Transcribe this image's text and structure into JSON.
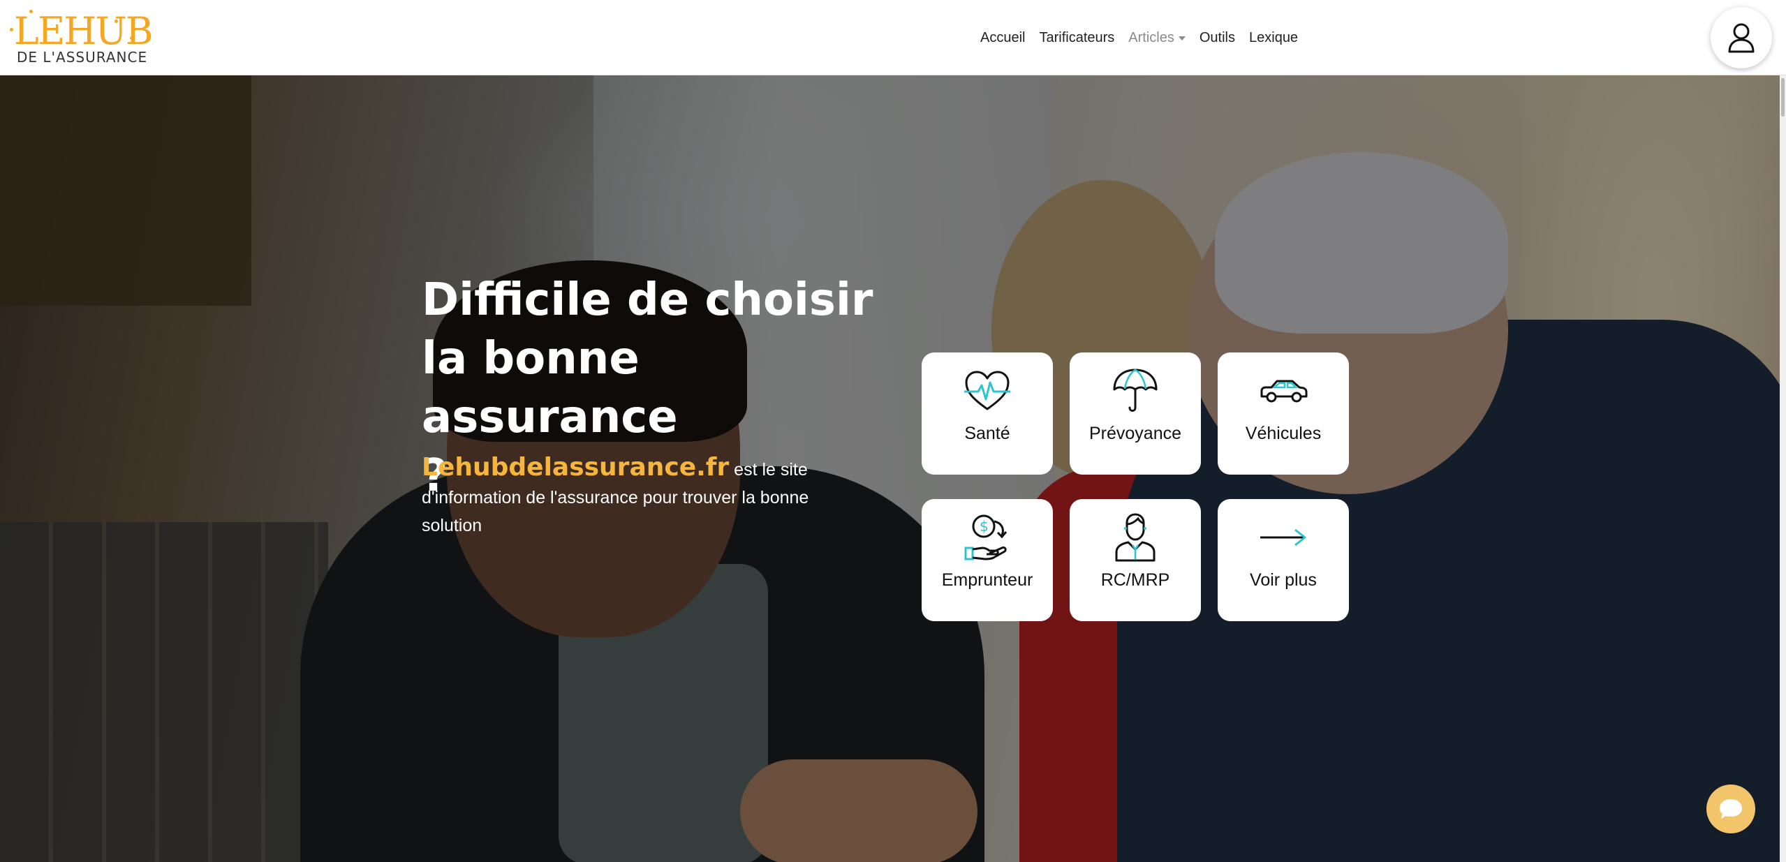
{
  "brand": {
    "logo_top": "LEHUB",
    "logo_bottom": "DE L'ASSURANCE",
    "accent": "#f5a623"
  },
  "nav": {
    "items": [
      {
        "label": "Accueil"
      },
      {
        "label": "Tarificateurs"
      },
      {
        "label": "Articles",
        "dropdown": true
      },
      {
        "label": "Outils"
      },
      {
        "label": "Lexique"
      }
    ],
    "user_icon": "user-icon"
  },
  "hero": {
    "title_lines": [
      "Difficile de choisir",
      "la bonne assurance",
      "?"
    ],
    "site_name": "Lehubdelassurance.fr",
    "description": " est le site d'information de l'assurance pour trouver la bonne solution",
    "overlay_color": "#000000",
    "site_name_color": "#f6b53c"
  },
  "categories": [
    {
      "label": "Santé",
      "icon": "heart-pulse-icon"
    },
    {
      "label": "Prévoyance",
      "icon": "umbrella-icon"
    },
    {
      "label": "Véhicules",
      "icon": "car-icon"
    },
    {
      "label": "Emprunteur",
      "icon": "money-hand-icon"
    },
    {
      "label": "RC/MRP",
      "icon": "professional-icon"
    },
    {
      "label": "Voir plus",
      "icon": "arrow-right-icon"
    }
  ],
  "chat": {
    "icon": "chat-bubble-icon",
    "color": "#f3c56b"
  }
}
